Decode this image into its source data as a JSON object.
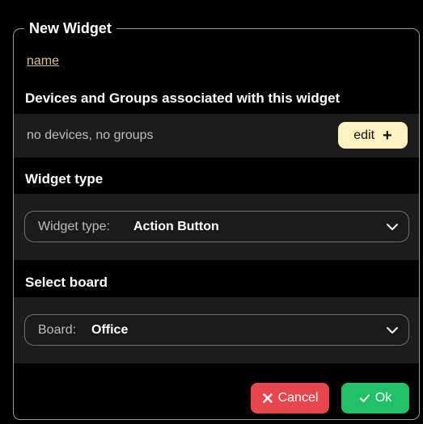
{
  "dialog": {
    "title": "New Widget",
    "name_link": "name"
  },
  "devices": {
    "title": "Devices and  Groups associated with this widget",
    "status": "no devices, no groups",
    "edit_label": "edit"
  },
  "widget_type": {
    "title": "Widget type",
    "select_label": "Widget type:",
    "select_value": "Action Button"
  },
  "board": {
    "title": "Select board",
    "select_label": "Board:",
    "select_value": "Office"
  },
  "actions": {
    "cancel_label": "Cancel",
    "ok_label": "Ok"
  },
  "colors": {
    "background": "#000000",
    "band": "#1c1c1c",
    "link": "#d6c68a",
    "edit_button": "#fff2c2",
    "cancel": "#e8464e",
    "ok": "#22c069"
  },
  "icons": {
    "edit_button": "plus-icon",
    "selects": "chevron-down-icon",
    "cancel": "close-icon",
    "ok": "check-icon"
  }
}
